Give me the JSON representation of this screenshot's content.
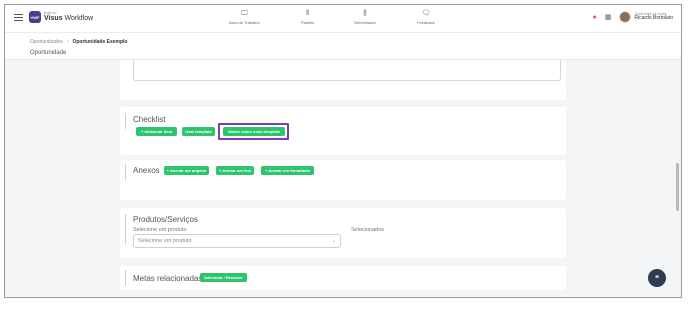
{
  "brand": {
    "logo_text": "VWF",
    "small": "Activ do",
    "name_bold": "Visus",
    "name_light": " Workflow"
  },
  "nav": [
    {
      "icon": "🖵",
      "label": "Área de Trabalho"
    },
    {
      "icon": "⦀",
      "label": "Painéis"
    },
    {
      "icon": "⫼",
      "label": "Gerenciador"
    },
    {
      "icon": "🗨",
      "label": "Feedback"
    }
  ],
  "user": {
    "greeting": "Você está na conta",
    "name": "Ricardo Bortolato"
  },
  "breadcrumb": {
    "parent": "Oportunidades",
    "separator": "›",
    "current": "Oportunidade Exemplo"
  },
  "page_subtitle": "Oportunidade",
  "checklist": {
    "title": "Checklist",
    "add_item": "+ Adicionar item",
    "use_template": "Usar template",
    "save_template": "Salvar como novo template"
  },
  "attachments": {
    "title": "Anexos",
    "file": "+ Anexar um arquivo",
    "link": "+ Anexar um link",
    "form": "+ Anexar um formulário"
  },
  "products": {
    "title": "Produtos/Serviços",
    "select_label": "Selecione um produto",
    "select_placeholder": "Selecione um produto",
    "selected_label": "Selecionados"
  },
  "goals": {
    "title": "Metas relacionadas",
    "button": "Adicionar / Remover"
  },
  "colors": {
    "accent_green": "#2ec46f",
    "highlight_purple": "#7b3fb5",
    "brand_purple": "#4b3b8f"
  }
}
